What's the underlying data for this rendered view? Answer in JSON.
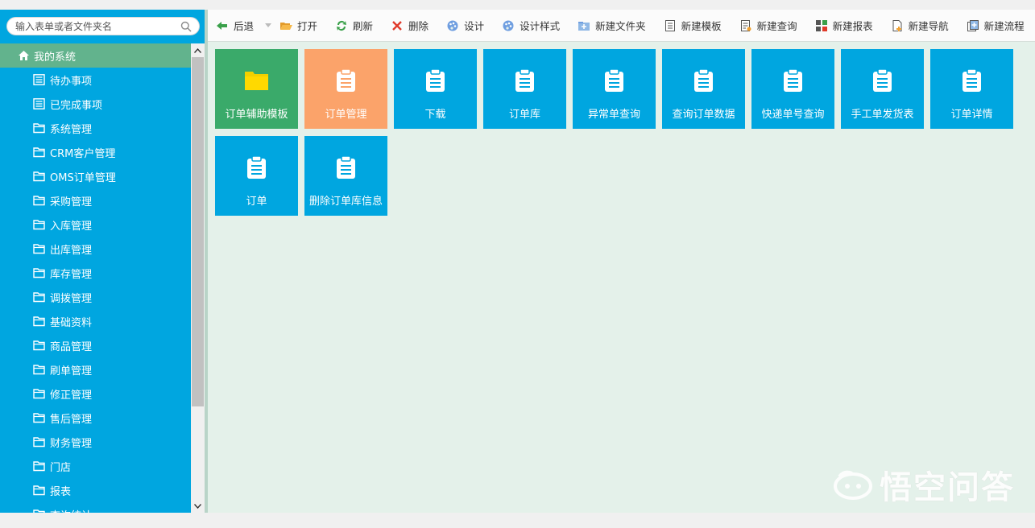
{
  "search": {
    "placeholder": "输入表单或者文件夹名"
  },
  "tree": {
    "root_label": "我的系统",
    "items": [
      {
        "label": "待办事项",
        "icon": "list-icon"
      },
      {
        "label": "已完成事项",
        "icon": "list-icon"
      },
      {
        "label": "系统管理",
        "icon": "folder-icon"
      },
      {
        "label": "CRM客户管理",
        "icon": "folder-icon"
      },
      {
        "label": "OMS订单管理",
        "icon": "folder-icon"
      },
      {
        "label": "采购管理",
        "icon": "folder-icon"
      },
      {
        "label": "入库管理",
        "icon": "folder-icon"
      },
      {
        "label": "出库管理",
        "icon": "folder-icon"
      },
      {
        "label": "库存管理",
        "icon": "folder-icon"
      },
      {
        "label": "调拨管理",
        "icon": "folder-icon"
      },
      {
        "label": "基础资料",
        "icon": "folder-icon"
      },
      {
        "label": "商品管理",
        "icon": "folder-icon"
      },
      {
        "label": "刷单管理",
        "icon": "folder-icon"
      },
      {
        "label": "修正管理",
        "icon": "folder-icon"
      },
      {
        "label": "售后管理",
        "icon": "folder-icon"
      },
      {
        "label": "财务管理",
        "icon": "folder-icon"
      },
      {
        "label": "门店",
        "icon": "folder-icon"
      },
      {
        "label": "报表",
        "icon": "folder-icon"
      },
      {
        "label": "查询统计",
        "icon": "folder-icon"
      }
    ]
  },
  "toolbar": {
    "back": "后退",
    "open": "打开",
    "refresh": "刷新",
    "delete": "删除",
    "design": "设计",
    "design_style": "设计样式",
    "new_folder": "新建文件夹",
    "new_template": "新建模板",
    "new_query": "新建查询",
    "new_report": "新建报表",
    "new_nav": "新建导航",
    "new_flow": "新建流程"
  },
  "tiles": [
    {
      "label": "订单辅助模板",
      "color": "#3aaa6a",
      "icon": "folder-icon"
    },
    {
      "label": "订单管理",
      "color": "#fba36a",
      "icon": "clipboard-icon"
    },
    {
      "label": "下载",
      "color": "#00a6e0",
      "icon": "clipboard-icon"
    },
    {
      "label": "订单库",
      "color": "#00a6e0",
      "icon": "clipboard-icon"
    },
    {
      "label": "异常单查询",
      "color": "#00a6e0",
      "icon": "clipboard-icon"
    },
    {
      "label": "查询订单数据",
      "color": "#00a6e0",
      "icon": "clipboard-icon"
    },
    {
      "label": "快递单号查询",
      "color": "#00a6e0",
      "icon": "clipboard-icon"
    },
    {
      "label": "手工单发货表",
      "color": "#00a6e0",
      "icon": "clipboard-icon"
    },
    {
      "label": "订单详情",
      "color": "#00a6e0",
      "icon": "clipboard-icon"
    },
    {
      "label": "订单",
      "color": "#00a6e0",
      "icon": "clipboard-icon"
    },
    {
      "label": "删除订单库信息",
      "color": "#00a6e0",
      "icon": "clipboard-icon"
    }
  ],
  "watermark": {
    "text": "悟空问答"
  },
  "colors": {
    "sidebar": "#00a6e0",
    "root_highlight": "#62b38d",
    "content_bg": "#e4f1ea",
    "tile_green": "#3aaa6a",
    "tile_orange": "#fba36a",
    "tile_blue": "#00a6e0"
  }
}
